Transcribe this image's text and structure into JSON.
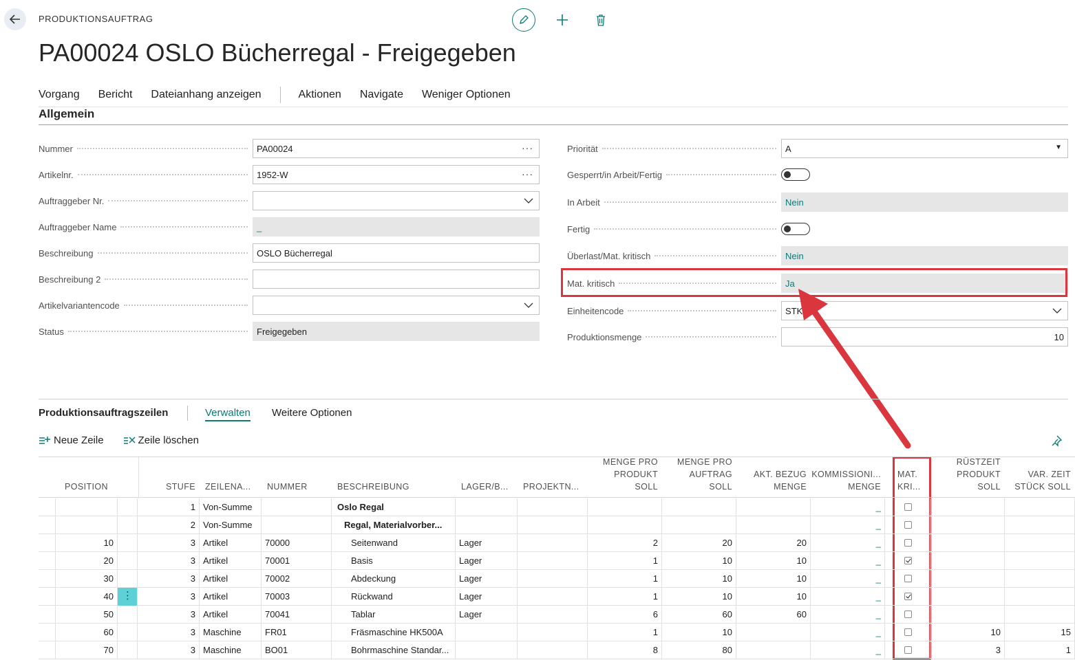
{
  "header": {
    "page_type": "PRODUKTIONSAUFTRAG",
    "title": "PA00024 OSLO Bücherregal - Freigegeben"
  },
  "action_bar": {
    "items": [
      "Vorgang",
      "Bericht",
      "Dateianhang anzeigen",
      "Aktionen",
      "Navigate",
      "Weniger Optionen"
    ]
  },
  "general": {
    "title": "Allgemein",
    "left": [
      {
        "label": "Nummer",
        "value": "PA00024"
      },
      {
        "label": "Artikelnr.",
        "value": "1952-W"
      },
      {
        "label": "Auftraggeber Nr.",
        "value": ""
      },
      {
        "label": "Auftraggeber Name",
        "value": "_"
      },
      {
        "label": "Beschreibung",
        "value": "OSLO Bücherregal"
      },
      {
        "label": "Beschreibung 2",
        "value": ""
      },
      {
        "label": "Artikelvariantencode",
        "value": ""
      },
      {
        "label": "Status",
        "value": "Freigegeben"
      }
    ],
    "right": [
      {
        "label": "Priorität",
        "value": "A"
      },
      {
        "label": "Gesperrt/in Arbeit/Fertig",
        "value": false
      },
      {
        "label": "In Arbeit",
        "value": "Nein"
      },
      {
        "label": "Fertig",
        "value": false
      },
      {
        "label": "Überlast/Mat. kritisch",
        "value": "Nein"
      },
      {
        "label": "Mat. kritisch",
        "value": "Ja"
      },
      {
        "label": "Einheitencode",
        "value": "STK"
      },
      {
        "label": "Produktionsmenge",
        "value": "10"
      }
    ]
  },
  "lines": {
    "title": "Produktionsauftragszeilen",
    "tabs": [
      "Verwalten",
      "Weitere Optionen"
    ],
    "actions": [
      "Neue Zeile",
      "Zeile löschen"
    ],
    "columns": {
      "position": "POSITION",
      "stufe": "STUFE",
      "zeilenart": "ZEILENA...",
      "nummer": "NUMMER",
      "beschreibung": "BESCHREIBUNG",
      "lager": "LAGER/B...",
      "projekt": "PROJEKTN...",
      "menge_pro_produkt": "MENGE PRO|PRODUKT|SOLL",
      "menge_pro_auftrag": "MENGE PRO|AUFTRAG|SOLL",
      "akt_bezug": "AKT. BEZUG|MENGE",
      "kommission": "KOMMISSIONI...|MENGE",
      "mat_kritisch": "MAT.|KRI...",
      "ruestzeit": "RÜSTZEIT|PRODUKT|SOLL",
      "var_zeit": "VAR. ZEIT|STÜCK SOLL"
    },
    "rows": [
      {
        "position": "",
        "stufe": "1",
        "zeilenart": "Von-Summe",
        "nummer": "",
        "beschreibung": "Oslo Regal",
        "bold": true,
        "indent": 0,
        "lager": "",
        "mpp": "",
        "mpa": "",
        "bezug": "",
        "kom": "_",
        "mat": false,
        "ruest": "",
        "var": ""
      },
      {
        "position": "",
        "stufe": "2",
        "zeilenart": "Von-Summe",
        "nummer": "",
        "beschreibung": "Regal, Materialvorber...",
        "bold": true,
        "indent": 1,
        "lager": "",
        "mpp": "",
        "mpa": "",
        "bezug": "",
        "kom": "_",
        "mat": false,
        "ruest": "",
        "var": ""
      },
      {
        "position": "10",
        "stufe": "3",
        "zeilenart": "Artikel",
        "nummer": "70000",
        "beschreibung": "Seitenwand",
        "bold": false,
        "indent": 2,
        "lager": "Lager",
        "mpp": "2",
        "mpa": "20",
        "bezug": "20",
        "kom": "_",
        "mat": false,
        "ruest": "",
        "var": ""
      },
      {
        "position": "20",
        "stufe": "3",
        "zeilenart": "Artikel",
        "nummer": "70001",
        "beschreibung": "Basis",
        "bold": false,
        "indent": 2,
        "lager": "Lager",
        "mpp": "1",
        "mpa": "10",
        "bezug": "10",
        "kom": "_",
        "mat": true,
        "ruest": "",
        "var": ""
      },
      {
        "position": "30",
        "stufe": "3",
        "zeilenart": "Artikel",
        "nummer": "70002",
        "beschreibung": "Abdeckung",
        "bold": false,
        "indent": 2,
        "lager": "Lager",
        "mpp": "1",
        "mpa": "10",
        "bezug": "10",
        "kom": "_",
        "mat": false,
        "ruest": "",
        "var": ""
      },
      {
        "position": "40",
        "stufe": "3",
        "zeilenart": "Artikel",
        "nummer": "70003",
        "beschreibung": "Rückwand",
        "bold": false,
        "indent": 2,
        "lager": "Lager",
        "mpp": "1",
        "mpa": "10",
        "bezug": "10",
        "kom": "_",
        "mat": true,
        "ruest": "",
        "var": "",
        "selected": true
      },
      {
        "position": "50",
        "stufe": "3",
        "zeilenart": "Artikel",
        "nummer": "70041",
        "beschreibung": "Tablar",
        "bold": false,
        "indent": 2,
        "lager": "Lager",
        "mpp": "6",
        "mpa": "60",
        "bezug": "60",
        "kom": "_",
        "mat": false,
        "ruest": "",
        "var": ""
      },
      {
        "position": "60",
        "stufe": "3",
        "zeilenart": "Maschine",
        "nummer": "FR01",
        "beschreibung": "Fräsmaschine HK500A",
        "bold": false,
        "indent": 2,
        "lager": "",
        "mpp": "1",
        "mpa": "10",
        "bezug": "",
        "kom": "_",
        "mat": false,
        "ruest": "10",
        "var": "15"
      },
      {
        "position": "70",
        "stufe": "3",
        "zeilenart": "Maschine",
        "nummer": "BO01",
        "beschreibung": "Bohrmaschine Standar...",
        "bold": false,
        "indent": 2,
        "lager": "",
        "mpp": "8",
        "mpa": "80",
        "bezug": "",
        "kom": "_",
        "mat": false,
        "ruest": "3",
        "var": "1"
      }
    ]
  },
  "colors": {
    "accent": "#0b7a75",
    "highlight": "#d9363e",
    "selected": "#5ed1d6"
  }
}
